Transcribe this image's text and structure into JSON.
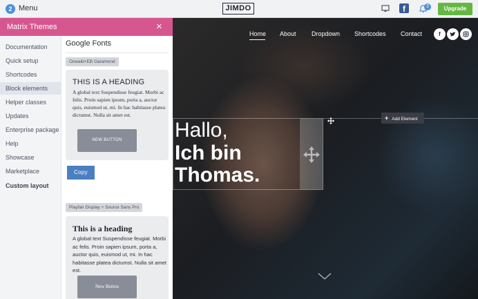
{
  "topbar": {
    "menu_badge": "2",
    "menu_label": "Menu",
    "logo": "JIMDO",
    "notifications_count": "3",
    "upgrade_label": "Upgrade",
    "upgrade_color": "#63b842"
  },
  "panel": {
    "title": "Matrix Themes",
    "close_symbol": "×",
    "header_color": "#d6578f"
  },
  "sidebar": {
    "items": [
      {
        "label": "Documentation"
      },
      {
        "label": "Quick setup"
      },
      {
        "label": "Shortcodes"
      },
      {
        "label": "Block elements",
        "active": true
      },
      {
        "label": "Helper classes"
      },
      {
        "label": "Updates"
      },
      {
        "label": "Enterprise package"
      },
      {
        "label": "Help"
      },
      {
        "label": "Showcase"
      },
      {
        "label": "Marketplace"
      },
      {
        "label": "Custom layout"
      }
    ]
  },
  "content": {
    "title": "Google Fonts",
    "font_pairs": [
      {
        "tag": "Oswald+EB Garamond",
        "heading": "THIS IS A HEADING",
        "text": "A global text Suspendisse feugiat. Morbi ac felis. Proin sapien ipsum, porta a, auctor quis, euismod ut, mi. In hac habitasse platea dictumst. Nulla sit amet est.",
        "button": "NEW BUTTON"
      },
      {
        "tag": "Playfair Display + Source Sans Pro",
        "heading": "This is a heading",
        "text": "A global text Suspendisse feugiat. Morbi ac felis. Proin sapien ipsum, porta a, auctor quis, euismod ut, mi. In hac habitasse platea dictumst. Nulla sit amet est.",
        "button": "New Button"
      }
    ],
    "copy_label": "Copy"
  },
  "preview": {
    "nav": [
      "Home",
      "About",
      "Dropdown",
      "Shortcodes",
      "Contact"
    ],
    "active_nav": "Home",
    "social": [
      "facebook-icon",
      "twitter-icon",
      "instagram-icon"
    ],
    "hero_line_1": "Hallo,",
    "hero_line_2": "Ich bin",
    "hero_line_3": "Thomas.",
    "add_element_label": "Add Element"
  }
}
